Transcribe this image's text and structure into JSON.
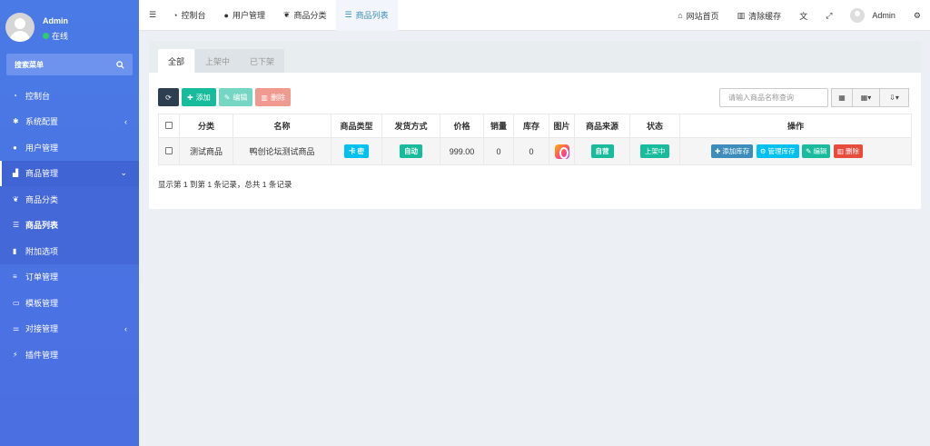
{
  "sidebar": {
    "user": {
      "name": "Admin",
      "status": "在线"
    },
    "search_label": "搜索菜单",
    "items": [
      {
        "label": "控制台",
        "icon": "dashboard-icon"
      },
      {
        "label": "系统配置",
        "icon": "gear-icon"
      },
      {
        "label": "用户管理",
        "icon": "user-icon"
      },
      {
        "label": "商品管理",
        "icon": "cart-icon"
      },
      {
        "label": "商品分类",
        "icon": "leaf-icon"
      },
      {
        "label": "商品列表",
        "icon": "list-icon"
      },
      {
        "label": "附加选项",
        "icon": "bookmark-icon"
      },
      {
        "label": "订单管理",
        "icon": "list-icon"
      },
      {
        "label": "模板管理",
        "icon": "keyboard-icon"
      },
      {
        "label": "对接管理",
        "icon": "sliders-icon"
      },
      {
        "label": "插件管理",
        "icon": "plug-icon"
      }
    ]
  },
  "header": {
    "tabs": [
      {
        "label": "控制台"
      },
      {
        "label": "用户管理"
      },
      {
        "label": "商品分类"
      },
      {
        "label": "商品列表"
      }
    ],
    "site_home": "网站首页",
    "clear_cache": "清除缓存",
    "user_name": "Admin"
  },
  "content": {
    "filter_tabs": [
      "全部",
      "上架中",
      "已下架"
    ],
    "toolbar": {
      "add": "添加",
      "edit": "编辑",
      "delete": "删除"
    },
    "search_placeholder": "请输入商品名称查询",
    "columns": [
      "分类",
      "名称",
      "商品类型",
      "发货方式",
      "价格",
      "销量",
      "库存",
      "图片",
      "商品来源",
      "状态",
      "操作"
    ],
    "row": {
      "category": "测试商品",
      "name": "鸭创论坛测试商品",
      "type": "卡 密",
      "delivery": "自动",
      "price": "999.00",
      "sales": "0",
      "stock": "0",
      "source": "自营",
      "status": "上架中",
      "actions": {
        "add_stock": "添加库存",
        "manage_stock": "管理库存",
        "edit": "编辑",
        "delete": "删除"
      }
    },
    "pagination_info": "显示第 1 到第 1 条记录，总共 1 条记录"
  },
  "colors": {
    "sidebar_bg": "#4a7ae6",
    "primary_green": "#18bc9c",
    "danger_red": "#e74c3c",
    "info_cyan": "#00c0ef",
    "blue": "#3c8dbc"
  }
}
